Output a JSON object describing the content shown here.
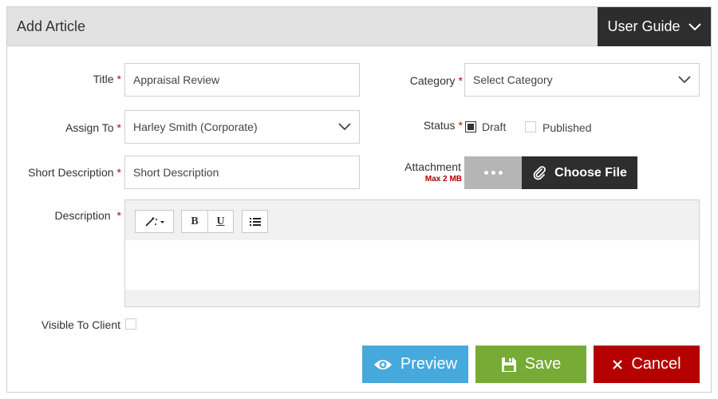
{
  "header": {
    "title": "Add Article",
    "guide_label": "User Guide"
  },
  "form": {
    "title": {
      "label": "Title",
      "value": "Appraisal Review"
    },
    "category": {
      "label": "Category",
      "value": "Select Category"
    },
    "assign_to": {
      "label": "Assign To",
      "value": "Harley Smith (Corporate)"
    },
    "status": {
      "label": "Status",
      "options": [
        {
          "label": "Draft",
          "checked": true
        },
        {
          "label": "Published",
          "checked": false
        }
      ]
    },
    "short_description": {
      "label": "Short Description",
      "placeholder": "Short Description"
    },
    "attachment": {
      "label": "Attachment",
      "hint": "Max 2 MB",
      "button": "Choose File"
    },
    "description": {
      "label": "Description",
      "toolbar": {
        "bold": "B",
        "underline": "U"
      }
    },
    "visible_to_client": {
      "label": "Visible To Client",
      "checked": false
    },
    "required_mark": "*"
  },
  "actions": {
    "preview": "Preview",
    "save": "Save",
    "cancel": "Cancel"
  },
  "colors": {
    "preview": "#45a9dd",
    "save": "#76ab35",
    "cancel": "#b50000",
    "dark": "#2d2d2d",
    "required": "#cc0000"
  }
}
